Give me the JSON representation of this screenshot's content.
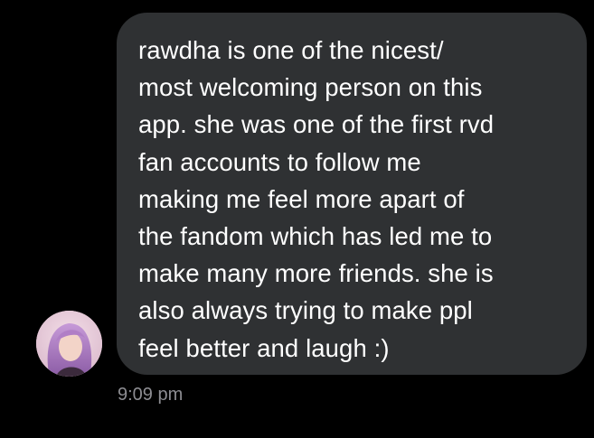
{
  "conversation": {
    "message": {
      "lines": [
        "rawdha is one of the nicest/",
        "most welcoming person on this",
        "app. she was one of the first rvd",
        "fan accounts to follow me",
        "making me feel more apart of",
        "the fandom which has led me to",
        "make many more friends. she is",
        "also always trying to make ppl",
        "feel better and laugh :)"
      ],
      "timestamp": "9:09 pm"
    },
    "avatar_icon": "profile-photo-icon"
  },
  "colors": {
    "background": "#000000",
    "bubble": "#2f3133",
    "message_text": "#ffffff",
    "timestamp": "#8d8d92"
  }
}
